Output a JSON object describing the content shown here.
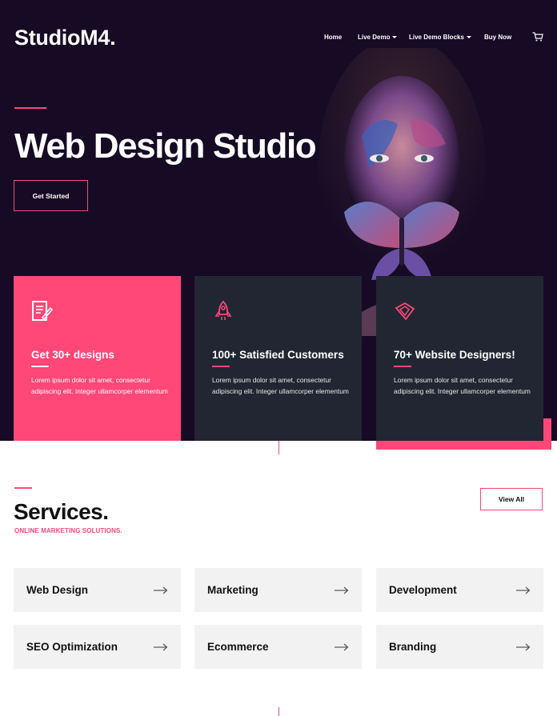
{
  "brand": {
    "name": "StudioM4."
  },
  "nav": {
    "items": [
      {
        "label": "Home"
      },
      {
        "label": "Live Demo"
      },
      {
        "label": "Live Demo Blocks"
      },
      {
        "label": "Buy Now"
      }
    ],
    "cart_icon": "cart-icon"
  },
  "hero": {
    "title": "Web Design Studio",
    "cta_label": "Get Started"
  },
  "features": [
    {
      "title": "Get 30+ designs",
      "text": "Lorem ipsum dolor sit amet, consectetur adipiscing elit. Integer ullamcorper elementum",
      "icon": "document-edit-icon"
    },
    {
      "title": "100+ Satisfied Customers",
      "text": "Lorem ipsum dolor sit amet, consectetur adipiscing elit. Integer ullamcorper elementum",
      "icon": "rocket-icon"
    },
    {
      "title": "70+ Website Designers!",
      "text": "Lorem ipsum dolor sit amet, consectetur adipiscing elit. Integer ullamcorper elementum",
      "icon": "diamond-icon"
    }
  ],
  "services": {
    "title": "Services.",
    "subtitle": "ONLINE MARKETING SOLUTIONS.",
    "view_all_label": "View All",
    "items": [
      {
        "label": "Web Design"
      },
      {
        "label": "Marketing"
      },
      {
        "label": "Development"
      },
      {
        "label": "SEO Optimization"
      },
      {
        "label": "Ecommerce"
      },
      {
        "label": "Branding"
      }
    ]
  },
  "colors": {
    "accent": "#ff4778",
    "hero_bg": "#160a24",
    "card_dark": "#222632",
    "tile_bg": "#f2f2f2"
  }
}
